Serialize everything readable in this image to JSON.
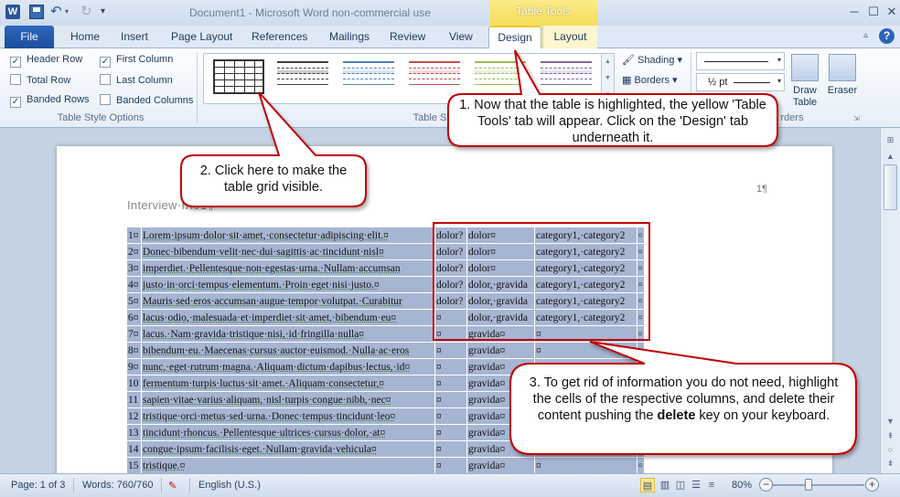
{
  "titlebar": {
    "word_icon": "W",
    "title": "Document1 - Microsoft Word non-commercial use",
    "contextual_tab_title": "Table Tools",
    "undo_icon": "undo-icon",
    "redo_icon": "redo-icon"
  },
  "tabs": {
    "file": "File",
    "home": "Home",
    "insert": "Insert",
    "page_layout": "Page Layout",
    "references": "References",
    "mailings": "Mailings",
    "review": "Review",
    "view": "View",
    "design": "Design",
    "layout": "Layout",
    "help": "?"
  },
  "ribbon": {
    "table_style_options": {
      "header_row": "Header Row",
      "first_column": "First Column",
      "total_row": "Total Row",
      "last_column": "Last Column",
      "banded_rows": "Banded Rows",
      "banded_columns": "Banded Columns",
      "group_label": "Table Style Options",
      "checked": {
        "header_row": true,
        "first_column": true,
        "total_row": false,
        "last_column": false,
        "banded_rows": true,
        "banded_columns": false
      }
    },
    "table_styles": {
      "group_label": "Table S",
      "thumb_colors": [
        "#333333",
        "#404040",
        "#4f81bd",
        "#c0504d",
        "#9bbb59",
        "#8064a2"
      ]
    },
    "shading": "Shading",
    "borders": "Borders",
    "pen_weight": "½ pt",
    "draw_borders_label": "rders",
    "draw_table": "Draw\nTable",
    "eraser": "Eraser"
  },
  "document": {
    "heading": "Interview·IX01¶",
    "page_mark": "1¶",
    "rows": [
      [
        "1¤",
        "Lorem·ipsum·dolor·sit·amet,·consectetur·adipiscing·elit.¤",
        "dolor?",
        "dolor¤",
        "category1,·category2",
        "¤"
      ],
      [
        "2¤",
        "Donec·bibendum·velit·nec·dui·sagittis·ac·tincidunt·nisl¤",
        "dolor?",
        "dolor¤",
        "category1,·category2",
        "¤"
      ],
      [
        "3¤",
        "imperdiet.·Pellentesque·non·egestas·urna.·Nullam·accumsan",
        "dolor?",
        "dolor¤",
        "category1,·category2",
        "¤"
      ],
      [
        "4¤",
        "justo·in·orci·tempus·elementum.·Proin·eget·nisi·justo.¤",
        "dolor?",
        "dolor,·gravida",
        "category1,·category2",
        "¤"
      ],
      [
        "5¤",
        "Mauris·sed·eros·accumsan·augue·tempor·volutpat.·Curabitur",
        "dolor?",
        "dolor,·gravida",
        "category1,·category2",
        "¤"
      ],
      [
        "6¤",
        "lacus·odio,·malesuada·et·imperdiet·sit·amet,·bibendum·eu¤",
        "¤",
        "dolor,·gravida",
        "category1,·category2",
        "¤"
      ],
      [
        "7¤",
        "lacus.·Nam·gravida·tristique·nisi,·id·fringilla·nulla¤",
        "¤",
        "gravida¤",
        "¤",
        "¤"
      ],
      [
        "8¤",
        "bibendum·eu.·Maecenas·cursus·auctor·euismod.·Nulla·ac·eros",
        "¤",
        "gravida¤",
        "¤",
        "¤"
      ],
      [
        "9¤",
        "nunc,·eget·rutrum·magna.·Aliquam·dictum·dapibus·lectus,·id¤",
        "¤",
        "gravida¤",
        "¤",
        "¤"
      ],
      [
        "10",
        "fermentum·turpis·luctus·sit·amet.·Aliquam·consectetur,¤",
        "¤",
        "gravida¤",
        "¤",
        "¤"
      ],
      [
        "11",
        "sapien·vitae·varius·aliquam,·nisl·turpis·congue·nibh,·nec¤",
        "¤",
        "gravida¤",
        "¤",
        "¤"
      ],
      [
        "12",
        "tristique·orci·metus·sed·urna.·Donec·tempus·tincidunt·leo¤",
        "¤",
        "gravida¤",
        "¤",
        "¤"
      ],
      [
        "13",
        "tincidunt·rhoncus.·Pellentesque·ultrices·cursus·dolor,·at¤",
        "¤",
        "gravida¤",
        "¤",
        "¤"
      ],
      [
        "14",
        "congue·ipsum·facilisis·eget.·Nullam·gravida·vehicula¤",
        "¤",
        "gravida¤",
        "¤",
        "¤"
      ],
      [
        "15",
        "tristique.¤",
        "¤",
        "gravida¤",
        "¤",
        "¤"
      ]
    ]
  },
  "statusbar": {
    "page": "Page: 1 of 3",
    "words": "Words: 760/760",
    "language": "English (U.S.)",
    "zoom": "80%",
    "zoom_minus": "−",
    "zoom_plus": "+"
  },
  "callouts": {
    "c1": "1. Now that the table is highlighted, the yellow 'Table Tools' tab will appear. Click on the 'Design' tab underneath it.",
    "c2": "2. Click here to make the table grid visible.",
    "c3_before": "3. To get rid of information you do not need, highlight the cells of the respective columns, and delete their content pushing the ",
    "c3_bold": "delete",
    "c3_after": " key on your keyboard."
  },
  "colors": {
    "accent_red": "#c00000",
    "contextual_yellow": "#f6dd5a",
    "selection": "#a6b5d2"
  }
}
